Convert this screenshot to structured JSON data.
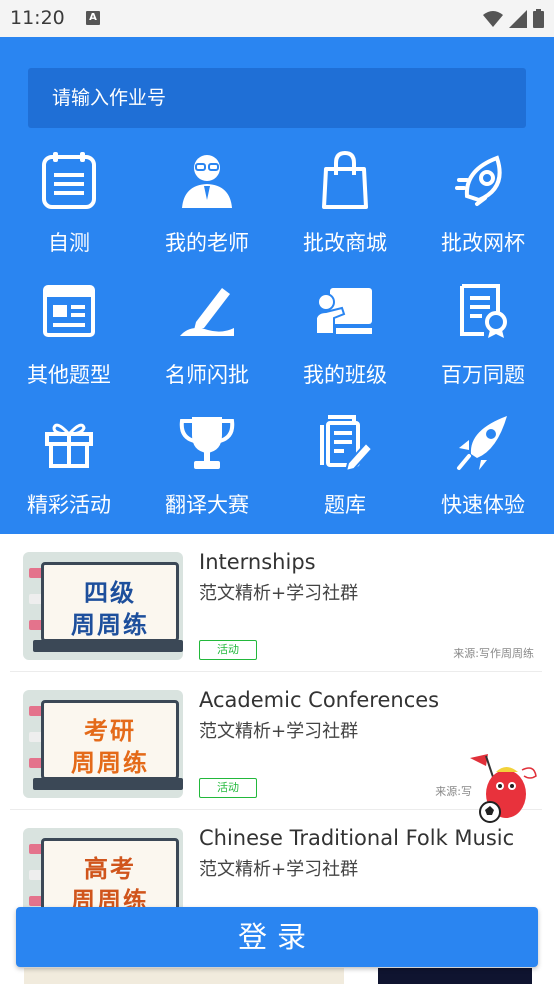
{
  "status": {
    "time": "11:20",
    "a_glyph": "A"
  },
  "search": {
    "placeholder": "请输入作业号"
  },
  "grid": [
    {
      "label": "自测",
      "icon": "checklist-icon"
    },
    {
      "label": "我的老师",
      "icon": "teacher-icon"
    },
    {
      "label": "批改商城",
      "icon": "shopping-bag-icon"
    },
    {
      "label": "批改网杯",
      "icon": "rocket-icon"
    },
    {
      "label": "其他题型",
      "icon": "browser-window-icon"
    },
    {
      "label": "名师闪批",
      "icon": "pencil-icon"
    },
    {
      "label": "我的班级",
      "icon": "classroom-icon"
    },
    {
      "label": "百万同题",
      "icon": "certificate-icon"
    },
    {
      "label": "精彩活动",
      "icon": "gift-icon"
    },
    {
      "label": "翻译大赛",
      "icon": "trophy-icon"
    },
    {
      "label": "题库",
      "icon": "documents-icon"
    },
    {
      "label": "快速体验",
      "icon": "rocket-icon"
    }
  ],
  "list": [
    {
      "title": "Internships",
      "subtitle": "范文精析+学习社群",
      "badge": "活动",
      "source": "来源:写作周周练",
      "thumb_line1": "四级",
      "thumb_line2": "周周练",
      "thumb_color": "#1d4f9c"
    },
    {
      "title": "Academic Conferences",
      "subtitle": "范文精析+学习社群",
      "badge": "活动",
      "source": "来源:写",
      "thumb_line1": "考研",
      "thumb_line2": "周周练",
      "thumb_color": "#e46a19"
    },
    {
      "title": "Chinese Traditional Folk Music",
      "subtitle": "范文精析+学习社群",
      "badge": "",
      "source": "",
      "thumb_line1": "高考",
      "thumb_line2": "周周练",
      "thumb_color": "#d0551c"
    }
  ],
  "login": {
    "label": "登录"
  },
  "colors": {
    "primary": "#2a85f1",
    "search_bg": "#1f6fd6",
    "badge_green": "#22b83b"
  }
}
